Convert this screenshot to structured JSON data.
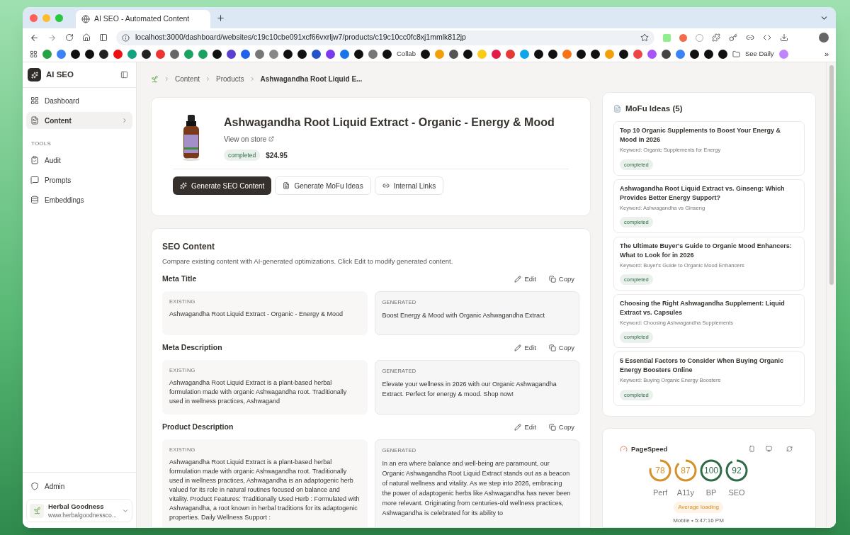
{
  "browser": {
    "tab_title": "AI SEO - Automated Content",
    "url": "localhost:3000/dashboard/websites/c19c10cbe091xcf66vxrljw7/products/c19c10cc0fc8xj1mmlk812jp",
    "bookmarks": [
      {
        "label": "Collab"
      },
      {
        "label": "See Daily"
      }
    ],
    "more": "»"
  },
  "sidebar": {
    "brand": "AI SEO",
    "nav": [
      {
        "label": "Dashboard",
        "selected": false,
        "expandable": false
      },
      {
        "label": "Content",
        "selected": true,
        "expandable": true
      }
    ],
    "section": "TOOLS",
    "tools": [
      {
        "label": "Audit",
        "selected": false
      },
      {
        "label": "Prompts",
        "selected": false
      },
      {
        "label": "Embeddings",
        "selected": false
      }
    ],
    "admin": "Admin",
    "site": {
      "name": "Herbal Goodness",
      "url": "www.herbalgoodnessco..."
    }
  },
  "breadcrumb": [
    "Content",
    "Products",
    "Ashwagandha Root Liquid E..."
  ],
  "product": {
    "title": "Ashwagandha Root Liquid Extract - Organic - Energy & Mood",
    "link": "View on store",
    "status": "completed",
    "price": "$24.95",
    "actions": [
      {
        "label": "Generate SEO Content",
        "primary": true
      },
      {
        "label": "Generate MoFu Ideas",
        "primary": false
      },
      {
        "label": "Internal Links",
        "primary": false
      }
    ]
  },
  "seo": {
    "title": "SEO Content",
    "description": "Compare existing content with AI-generated optimizations. Click Edit to modify generated content.",
    "fields": [
      {
        "label": "Meta Title",
        "edit": "Edit",
        "copy": "Copy",
        "existing_label": "EXISTING",
        "existing": "Ashwagandha Root Liquid Extract - Organic - Energy & Mood",
        "generated_label": "GENERATED",
        "generated": "Boost Energy & Mood with Organic Ashwagandha Extract"
      },
      {
        "label": "Meta Description",
        "edit": "Edit",
        "copy": "Copy",
        "existing_label": "EXISTING",
        "existing": "Ashwagandha Root Liquid Extract is a plant-based herbal formulation made with organic Ashwagandha root. Traditionally used in wellness practices, Ashwagand",
        "generated_label": "GENERATED",
        "generated": "Elevate your wellness in 2026 with our Organic Ashwagandha Extract. Perfect for energy & mood. Shop now!"
      },
      {
        "label": "Product Description",
        "edit": "Edit",
        "copy": "Copy",
        "existing_label": "EXISTING",
        "existing": "Ashwagandha Root Liquid Extract is a plant-based herbal formulation made with organic Ashwagandha root. Traditionally used in wellness practices, Ashwagandha is an adaptogenic herb valued for its role in natural routines focused on balance and vitality. Product Features: Traditionally Used Herb : Formulated with Ashwagandha, a root known in herbal traditions for its adaptogenic properties. Daily Wellness Support :",
        "generated_label": "GENERATED",
        "generated": "In an era where balance and well-being are paramount, our Organic Ashwagandha Root Liquid Extract stands out as a beacon of natural wellness and vitality. As we step into 2026, embracing the power of adaptogenic herbs like Ashwagandha has never been more relevant. Originating from centuries-old wellness practices, Ashwagandha is celebrated for its ability to"
      }
    ]
  },
  "mofu": {
    "title": "MoFu Ideas (5)",
    "ideas": [
      {
        "title": "Top 10 Organic Supplements to Boost Your Energy & Mood in 2026",
        "keyword": "Keyword: Organic Supplements for Energy",
        "status": "completed"
      },
      {
        "title": "Ashwagandha Root Liquid Extract vs. Ginseng: Which Provides Better Energy Support?",
        "keyword": "Keyword: Ashwagandha vs Ginseng",
        "status": "completed"
      },
      {
        "title": "The Ultimate Buyer's Guide to Organic Mood Enhancers: What to Look for in 2026",
        "keyword": "Keyword: Buyer's Guide to Organic Mood Enhancers",
        "status": "completed"
      },
      {
        "title": "Choosing the Right Ashwagandha Supplement: Liquid Extract vs. Capsules",
        "keyword": "Keyword: Choosing Ashwagandha Supplements",
        "status": "completed"
      },
      {
        "title": "5 Essential Factors to Consider When Buying Organic Energy Boosters Online",
        "keyword": "Keyword: Buying Organic Energy Boosters",
        "status": "completed"
      }
    ]
  },
  "pagespeed": {
    "title": "PageSpeed",
    "scores": [
      {
        "value": "78",
        "label": "Perf",
        "color": "#d4912a"
      },
      {
        "value": "87",
        "label": "A11y",
        "color": "#d4912a"
      },
      {
        "value": "100",
        "label": "BP",
        "color": "#2f6b46"
      },
      {
        "value": "92",
        "label": "SEO",
        "color": "#2f6b46"
      }
    ],
    "assessment": "Average loading",
    "footer": "Mobile • 5:47:16 PM"
  }
}
